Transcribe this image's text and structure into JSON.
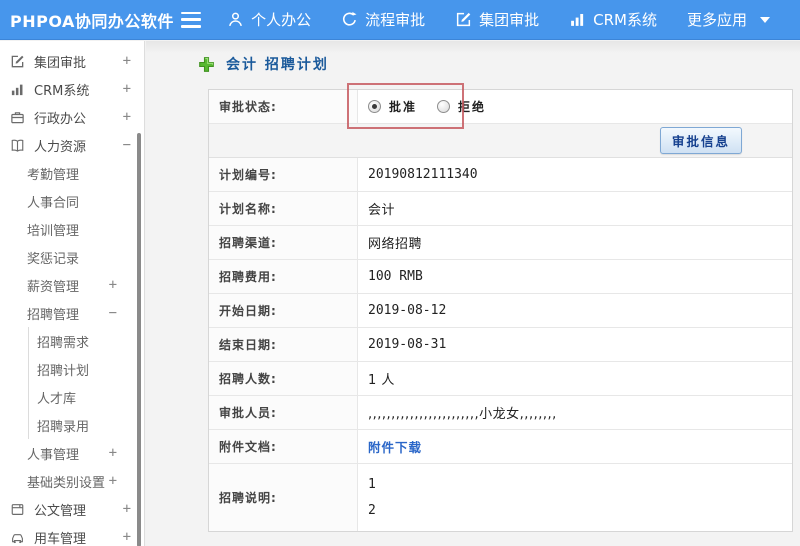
{
  "topbar": {
    "logo": "PHPOA协同办公软件",
    "nav": [
      {
        "id": "personal-office",
        "icon": "user",
        "label": "个人办公"
      },
      {
        "id": "workflow-approval",
        "icon": "history",
        "label": "流程审批"
      },
      {
        "id": "group-approval",
        "icon": "edit",
        "label": "集团审批"
      },
      {
        "id": "crm-system",
        "icon": "chart",
        "label": "CRM系统"
      },
      {
        "id": "more-apps",
        "icon": "",
        "label": "更多应用",
        "caret": true
      }
    ]
  },
  "sidebar": {
    "items": [
      {
        "label": "集团审批",
        "level": 1,
        "icon": "edit",
        "expander": "+"
      },
      {
        "label": "CRM系统",
        "level": 1,
        "icon": "chart",
        "expander": "+"
      },
      {
        "label": "行政办公",
        "level": 1,
        "icon": "briefcase",
        "expander": "+"
      },
      {
        "label": "人力资源",
        "level": 1,
        "icon": "book",
        "expander": "−"
      },
      {
        "label": "考勤管理",
        "level": 2
      },
      {
        "label": "人事合同",
        "level": 2
      },
      {
        "label": "培训管理",
        "level": 2
      },
      {
        "label": "奖惩记录",
        "level": 2
      },
      {
        "label": "薪资管理",
        "level": 2,
        "expander": "+"
      },
      {
        "label": "招聘管理",
        "level": 2,
        "expander": "−"
      },
      {
        "label": "招聘需求",
        "level": 3
      },
      {
        "label": "招聘计划",
        "level": 3
      },
      {
        "label": "人才库",
        "level": 3
      },
      {
        "label": "招聘录用",
        "level": 3
      },
      {
        "label": "人事管理",
        "level": 2,
        "expander": "+"
      },
      {
        "label": "基础类别设置",
        "level": 2,
        "expander": "+"
      },
      {
        "label": "公文管理",
        "level": 1,
        "icon": "document",
        "expander": "+"
      },
      {
        "label": "用车管理",
        "level": 1,
        "icon": "car",
        "expander": "+"
      }
    ]
  },
  "main": {
    "breadcrumb": "会计 招聘计划",
    "approval": {
      "label": "审批状态:",
      "options": [
        {
          "label": "批准",
          "selected": true
        },
        {
          "label": "拒绝",
          "selected": false
        }
      ]
    },
    "approval_info_button": "审批信息",
    "rows": [
      {
        "label": "计划编号:",
        "value": "20190812111340",
        "type": "mono"
      },
      {
        "label": "计划名称:",
        "value": "会计",
        "type": "text"
      },
      {
        "label": "招聘渠道:",
        "value": "网络招聘",
        "type": "text"
      },
      {
        "label": "招聘费用:",
        "value": "100 RMB",
        "type": "mono"
      },
      {
        "label": "开始日期:",
        "value": "2019-08-12",
        "type": "mono"
      },
      {
        "label": "结束日期:",
        "value": "2019-08-31",
        "type": "mono"
      },
      {
        "label": "招聘人数:",
        "value": "1 人",
        "type": "text"
      },
      {
        "label": "审批人员:",
        "value": ",,,,,,,,,,,,,,,,,,,,,,,,小龙女,,,,,,,,",
        "type": "text"
      },
      {
        "label": "附件文档:",
        "value": "附件下载",
        "type": "link"
      },
      {
        "label": "招聘说明:",
        "value": [
          "1",
          "2"
        ],
        "type": "multiline"
      }
    ]
  },
  "colors": {
    "topbar_blue": "#4796ec",
    "breadcrumb_text": "#1b5a9b",
    "link_blue": "#2a66c8",
    "annotation_red": "#c5595f",
    "plus_icon_green": "#58b832"
  }
}
